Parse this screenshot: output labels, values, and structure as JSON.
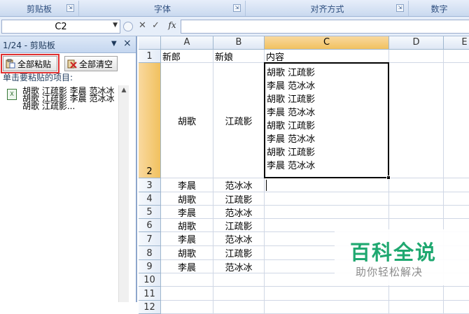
{
  "ribbon": {
    "groups": [
      "剪贴板",
      "字体",
      "对齐方式",
      "数字"
    ]
  },
  "formula_bar": {
    "name_box": "C2",
    "cancel_icon": "✕",
    "enter_icon": "✓",
    "fx_label": "fx",
    "content": ""
  },
  "clipboard_pane": {
    "title": "1/24 - 剪贴板",
    "paste_all_label": "全部粘贴",
    "clear_all_label": "全部清空",
    "hint": "单击要粘贴的项目:",
    "items": [
      {
        "text": "胡歌 江疏影 李晨 范冰冰 胡歌 江疏影 李晨 范冰冰 胡歌 江疏影..."
      }
    ]
  },
  "sheet": {
    "columns": [
      "A",
      "B",
      "C",
      "D",
      "E"
    ],
    "selected_column": "C",
    "selected_row": "2",
    "active_cell": "C2",
    "row_numbers": [
      "1",
      "2",
      "3",
      "4",
      "5",
      "6",
      "7",
      "8",
      "9",
      "10",
      "11",
      "12"
    ],
    "header_row": {
      "A": "新郎",
      "B": "新娘",
      "C": "内容"
    },
    "c2_lines": [
      "胡歌 江疏影",
      "李晨 范冰冰",
      "胡歌 江疏影",
      "李晨 范冰冰",
      "胡歌 江疏影",
      "李晨 范冰冰",
      "胡歌 江疏影",
      "李晨 范冰冰"
    ],
    "row2": {
      "A": "胡歌",
      "B": "江疏影"
    },
    "data_rows": [
      {
        "row": "3",
        "A": "李晨",
        "B": "范冰冰"
      },
      {
        "row": "4",
        "A": "胡歌",
        "B": "江疏影"
      },
      {
        "row": "5",
        "A": "李晨",
        "B": "范冰冰"
      },
      {
        "row": "6",
        "A": "胡歌",
        "B": "江疏影"
      },
      {
        "row": "7",
        "A": "李晨",
        "B": "范冰冰"
      },
      {
        "row": "8",
        "A": "胡歌",
        "B": "江疏影"
      },
      {
        "row": "9",
        "A": "李晨",
        "B": "范冰冰"
      }
    ]
  },
  "watermark": {
    "brand": "百科全说",
    "slogan": "助你轻松解决"
  },
  "colors": {
    "selection_header": "#f1c15f",
    "watermark_green": "#1fa870",
    "paste_all_highlight": "#e03030"
  },
  "icons": [
    "clipboard-paste-icon",
    "clear-all-icon",
    "excel-clip-icon",
    "close-icon",
    "dropdown-arrow-icon",
    "dialog-launcher-icon"
  ]
}
